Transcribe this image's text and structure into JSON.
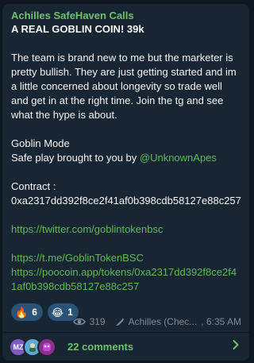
{
  "post": {
    "channel_name": "Achilles SafeHaven Calls",
    "title": "A REAL GOBLIN COIN! 39k",
    "paragraph_1": "The team is brand new to me but the marketer is pretty bullish. They are just getting started and im a little concerned about longevity so trade well and get in at the right time. Join the tg and see what the hype is about.",
    "goblin_mode": "Goblin Mode",
    "safe_play_prefix": "Safe play brought to you by ",
    "mention": "@UnknownApes",
    "contract_label": "Contract :",
    "contract_address": "0xa2317dd392f8ce2f41af0b398cdb58127e88c257",
    "twitter_link": "https://twitter.com/goblintokenbsc",
    "telegram_link": "https://t.me/GoblinTokenBSC",
    "poocoin_link": "https://poocoin.app/tokens/0xa2317dd392f8ce2f41af0b398cdb58127e88c257"
  },
  "reactions": [
    {
      "emoji": "🔥",
      "icon": "fire-emoji",
      "count": "6"
    },
    {
      "emoji": "😂",
      "icon": "laughing-emoji",
      "count": "1"
    }
  ],
  "meta": {
    "views": "319",
    "author": "Achilles (Chec...",
    "time": "6:35 AM"
  },
  "comments": {
    "avatar_initials": "MZ",
    "label": "22 comments"
  },
  "colors": {
    "background": "#0e1621",
    "bubble": "#182533",
    "accent_green": "#6fc06a",
    "reaction_bg": "#2b5278",
    "meta_gray": "#7d8b99"
  }
}
